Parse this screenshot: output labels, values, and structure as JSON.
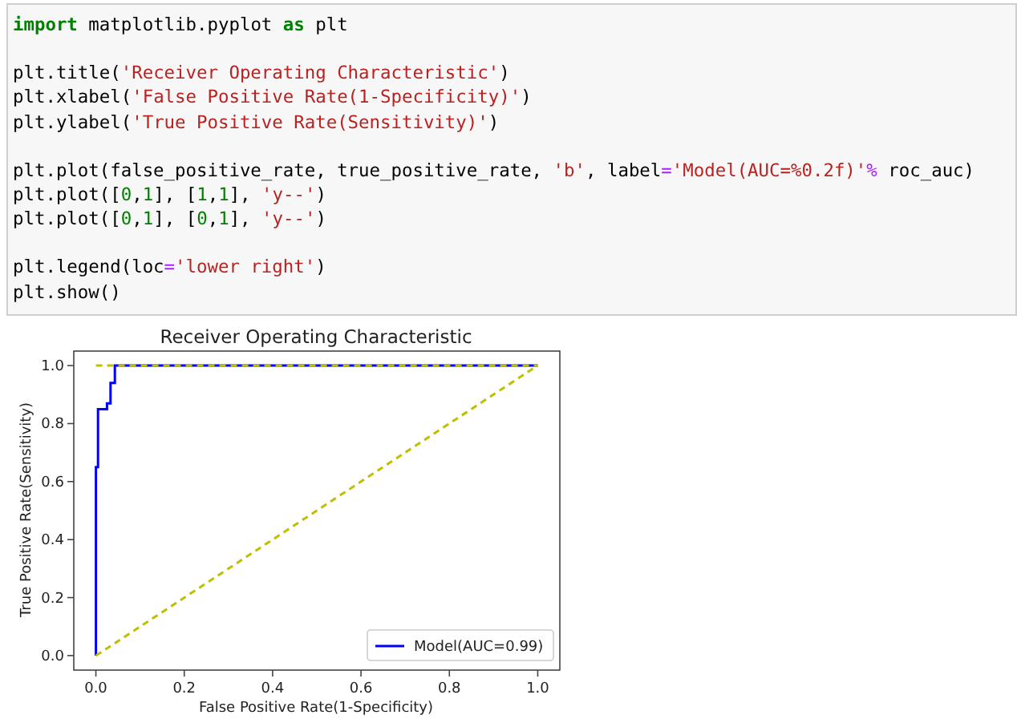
{
  "code_cell": {
    "blocks": [
      [
        [
          {
            "kind": "keyword",
            "text": "import"
          },
          {
            "kind": "plain",
            "text": " matplotlib.pyplot "
          },
          {
            "kind": "keyword",
            "text": "as"
          },
          {
            "kind": "plain",
            "text": " plt"
          }
        ]
      ],
      [
        [
          {
            "kind": "plain",
            "text": "plt.title("
          },
          {
            "kind": "string",
            "text": "'Receiver Operating Characteristic'"
          },
          {
            "kind": "plain",
            "text": ")"
          }
        ],
        [
          {
            "kind": "plain",
            "text": "plt.xlabel("
          },
          {
            "kind": "string",
            "text": "'False Positive Rate(1-Specificity)'"
          },
          {
            "kind": "plain",
            "text": ")"
          }
        ],
        [
          {
            "kind": "plain",
            "text": "plt.ylabel("
          },
          {
            "kind": "string",
            "text": "'True Positive Rate(Sensitivity)'"
          },
          {
            "kind": "plain",
            "text": ")"
          }
        ]
      ],
      [
        [
          {
            "kind": "plain",
            "text": "plt.plot(false_positive_rate, true_positive_rate, "
          },
          {
            "kind": "string",
            "text": "'b'"
          },
          {
            "kind": "plain",
            "text": ", label"
          },
          {
            "kind": "operator",
            "text": "="
          },
          {
            "kind": "string",
            "text": "'Model(AUC=%0.2f)'"
          },
          {
            "kind": "operator",
            "text": "%"
          },
          {
            "kind": "plain",
            "text": " roc_auc)"
          }
        ],
        [
          {
            "kind": "plain",
            "text": "plt.plot(["
          },
          {
            "kind": "number",
            "text": "0"
          },
          {
            "kind": "plain",
            "text": ","
          },
          {
            "kind": "number",
            "text": "1"
          },
          {
            "kind": "plain",
            "text": "], ["
          },
          {
            "kind": "number",
            "text": "1"
          },
          {
            "kind": "plain",
            "text": ","
          },
          {
            "kind": "number",
            "text": "1"
          },
          {
            "kind": "plain",
            "text": "], "
          },
          {
            "kind": "string",
            "text": "'y--'"
          },
          {
            "kind": "plain",
            "text": ")"
          }
        ],
        [
          {
            "kind": "plain",
            "text": "plt.plot(["
          },
          {
            "kind": "number",
            "text": "0"
          },
          {
            "kind": "plain",
            "text": ","
          },
          {
            "kind": "number",
            "text": "1"
          },
          {
            "kind": "plain",
            "text": "], ["
          },
          {
            "kind": "number",
            "text": "0"
          },
          {
            "kind": "plain",
            "text": ","
          },
          {
            "kind": "number",
            "text": "1"
          },
          {
            "kind": "plain",
            "text": "], "
          },
          {
            "kind": "string",
            "text": "'y--'"
          },
          {
            "kind": "plain",
            "text": ")"
          }
        ]
      ],
      [
        [
          {
            "kind": "plain",
            "text": "plt.legend(loc"
          },
          {
            "kind": "operator",
            "text": "="
          },
          {
            "kind": "string",
            "text": "'lower right'"
          },
          {
            "kind": "plain",
            "text": ")"
          }
        ],
        [
          {
            "kind": "plain",
            "text": "plt.show()"
          }
        ]
      ]
    ]
  },
  "output": {
    "chart_data": {
      "type": "line",
      "title": "Receiver Operating Characteristic",
      "xlabel": "False Positive Rate(1-Specificity)",
      "ylabel": "True Positive Rate(Sensitivity)",
      "xlim": [
        -0.05,
        1.05
      ],
      "ylim": [
        -0.05,
        1.05
      ],
      "xticks": [
        {
          "value": 0,
          "label": "0.0"
        },
        {
          "value": 0.2,
          "label": "0.2"
        },
        {
          "value": 0.4,
          "label": "0.4"
        },
        {
          "value": 0.6,
          "label": "0.6"
        },
        {
          "value": 0.8,
          "label": "0.8"
        },
        {
          "value": 1,
          "label": "1.0"
        }
      ],
      "yticks": [
        {
          "value": 0,
          "label": "0.0"
        },
        {
          "value": 0.2,
          "label": "0.2"
        },
        {
          "value": 0.4,
          "label": "0.4"
        },
        {
          "value": 0.6,
          "label": "0.6"
        },
        {
          "value": 0.8,
          "label": "0.8"
        },
        {
          "value": 1,
          "label": "1.0"
        }
      ],
      "series": [
        {
          "name": "Model(AUC=0.99)",
          "color": "#0000ff",
          "line_style": "solid",
          "x": [
            0,
            0,
            0.005,
            0.005,
            0.025,
            0.025,
            0.033,
            0.033,
            0.043,
            0.043,
            1
          ],
          "values": [
            0,
            0.65,
            0.65,
            0.85,
            0.85,
            0.87,
            0.87,
            0.94,
            0.94,
            1,
            1
          ]
        },
        {
          "color": "#bfbf00",
          "line_style": "dashed",
          "x": [
            0,
            1
          ],
          "values": [
            1,
            1
          ]
        },
        {
          "color": "#bfbf00",
          "line_style": "dashed",
          "x": [
            0,
            1
          ],
          "values": [
            0,
            1
          ]
        }
      ]
    }
  }
}
